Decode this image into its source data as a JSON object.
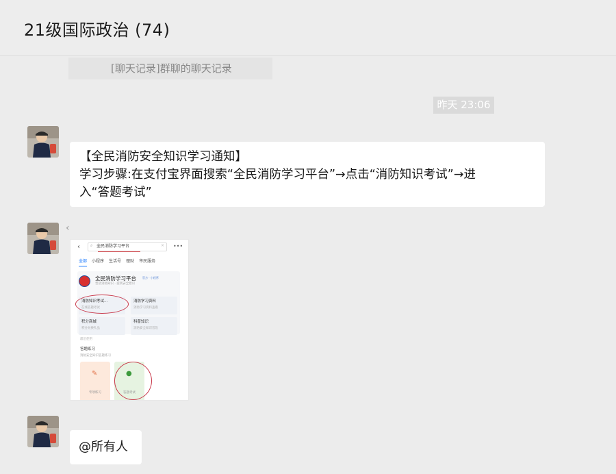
{
  "header": {
    "title": "21级国际政治 (74)"
  },
  "messages": {
    "quoted_record": "[聊天记录]群聊的聊天记录",
    "timestamp": "昨天 23:06",
    "notice": {
      "line1": "【全民消防安全知识学习通知】",
      "line2": "学习步骤:在支付宝界面搜索“全民消防学习平台”→点击“消防知识考试”→进",
      "line3": "入“答题考试”"
    },
    "mention": "@所有人"
  },
  "screenshot": {
    "search_query": "全民消防学习平台",
    "tabs": [
      "全部",
      "小程序",
      "生活号",
      "理财",
      "市民服务"
    ],
    "app_name": "全民消防学习平台",
    "app_tags": "官方 · 小程序",
    "app_sub": "普及消防知识 · 提高安全意识",
    "services": [
      {
        "title": "消防知识考试…",
        "sub": "在线答题考试"
      },
      {
        "title": "消防学习资料",
        "sub": "消防学习资料查看"
      },
      {
        "title": "积分商城",
        "sub": "积分兑换礼品"
      },
      {
        "title": "科普知识",
        "sub": "消防安全知识普及"
      }
    ],
    "section_label": "最近使用",
    "practice_title": "答题练习",
    "practice_sub": "消防安全知识答题练习",
    "tile_a_label": "专项练习",
    "tile_b_label": "答题考试"
  },
  "colors": {
    "background": "#ececec",
    "bubble": "#ffffff",
    "highlight_ring": "#c9394b",
    "accent_blue": "#1677ff"
  }
}
